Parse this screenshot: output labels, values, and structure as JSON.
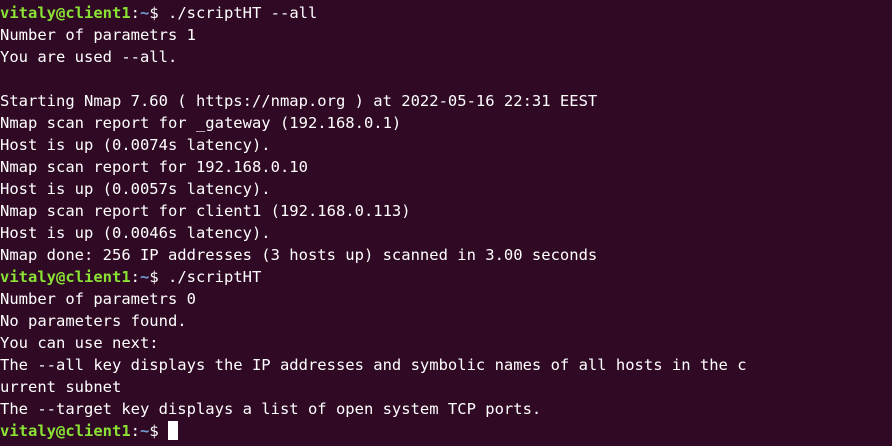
{
  "colors": {
    "background": "#300a24",
    "foreground": "#ffffff",
    "prompt_user": "#8ae234",
    "prompt_path": "#729fcf"
  },
  "prompt": {
    "user_host": "vitaly@client1",
    "separator": ":",
    "path": "~",
    "symbol": "$ "
  },
  "commands": {
    "first": "./scriptHT --all",
    "second": "./scriptHT"
  },
  "output_block_1": [
    "Number of parametrs 1",
    "You are used --all.",
    "",
    "Starting Nmap 7.60 ( https://nmap.org ) at 2022-05-16 22:31 EEST",
    "Nmap scan report for _gateway (192.168.0.1)",
    "Host is up (0.0074s latency).",
    "Nmap scan report for 192.168.0.10",
    "Host is up (0.0057s latency).",
    "Nmap scan report for client1 (192.168.0.113)",
    "Host is up (0.0046s latency).",
    "Nmap done: 256 IP addresses (3 hosts up) scanned in 3.00 seconds"
  ],
  "output_block_2": [
    "Number of parametrs 0",
    "No parameters found.",
    "You can use next:",
    "The --all key displays the IP addresses and symbolic names of all hosts in the c",
    "urrent subnet",
    "The --target key displays a list of open system TCP ports."
  ]
}
